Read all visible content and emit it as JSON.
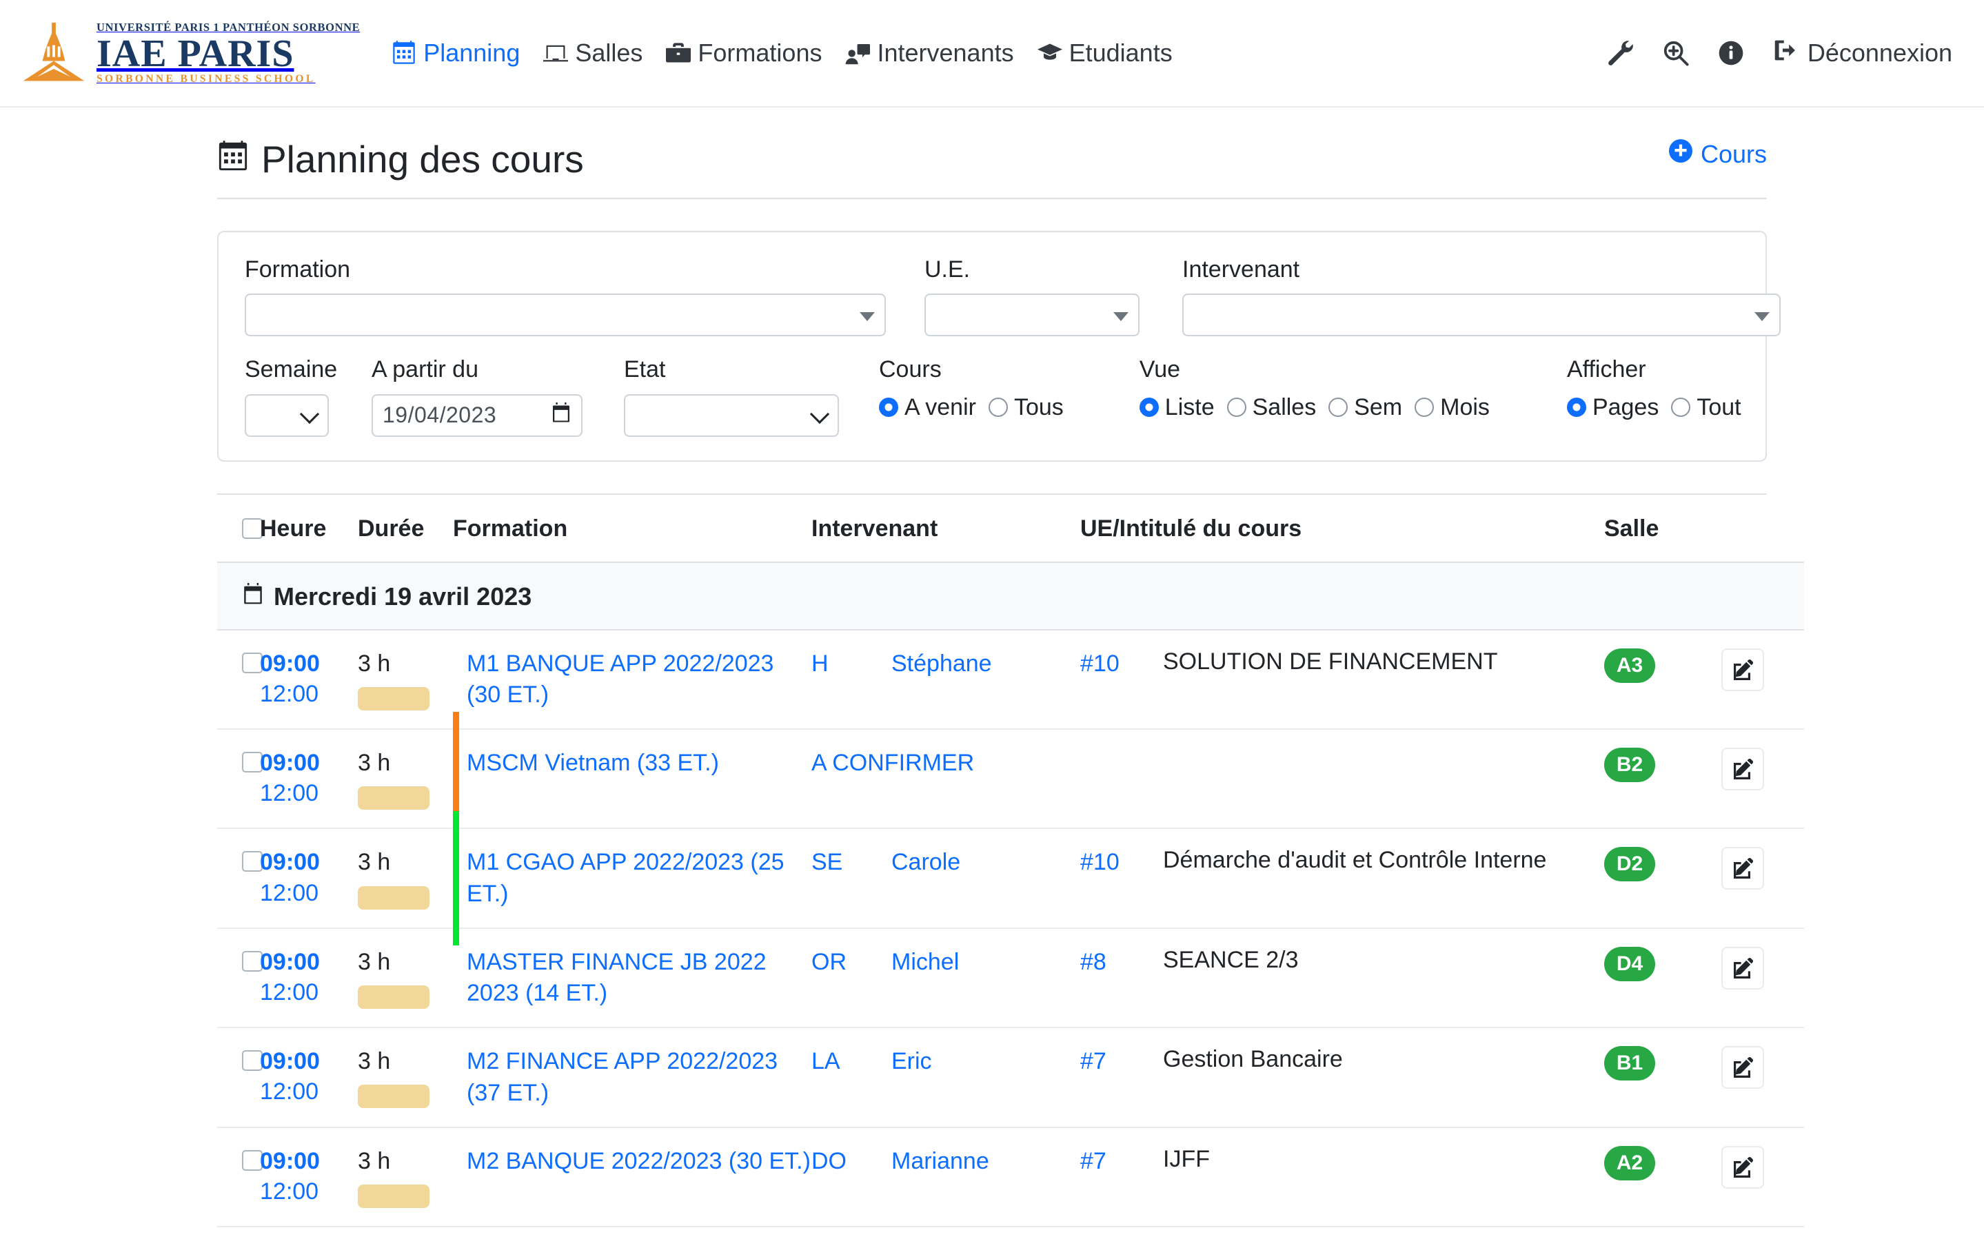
{
  "brand": {
    "line1": "UNIVERSITÉ PARIS 1 PANTHÉON SORBONNE",
    "line2": "IAE PARIS",
    "line3": "SORBONNE BUSINESS SCHOOL"
  },
  "nav": {
    "items": [
      {
        "label": "Planning",
        "icon": "calendar-icon",
        "active": true
      },
      {
        "label": "Salles",
        "icon": "laptop-icon",
        "active": false
      },
      {
        "label": "Formations",
        "icon": "briefcase-icon",
        "active": false
      },
      {
        "label": "Intervenants",
        "icon": "user-card-icon",
        "active": false
      },
      {
        "label": "Etudiants",
        "icon": "graduation-cap-icon",
        "active": false
      }
    ],
    "right_icons": [
      "wrench-icon",
      "search-plus-icon",
      "info-circle-icon"
    ],
    "logout_label": "Déconnexion"
  },
  "page": {
    "title": "Planning des cours",
    "add_button": "Cours"
  },
  "filters": {
    "formation": {
      "label": "Formation",
      "value": ""
    },
    "ue": {
      "label": "U.E.",
      "value": ""
    },
    "intervenant": {
      "label": "Intervenant",
      "value": ""
    },
    "semaine": {
      "label": "Semaine",
      "value": ""
    },
    "apartirdu": {
      "label": "A partir du",
      "value": "19/04/2023"
    },
    "etat": {
      "label": "Etat",
      "value": ""
    },
    "cours": {
      "label": "Cours",
      "options": [
        {
          "label": "A venir",
          "selected": true
        },
        {
          "label": "Tous",
          "selected": false
        }
      ]
    },
    "vue": {
      "label": "Vue",
      "options": [
        {
          "label": "Liste",
          "selected": true
        },
        {
          "label": "Salles",
          "selected": false
        },
        {
          "label": "Sem",
          "selected": false
        },
        {
          "label": "Mois",
          "selected": false
        }
      ]
    },
    "afficher": {
      "label": "Afficher",
      "options": [
        {
          "label": "Pages",
          "selected": true
        },
        {
          "label": "Tout",
          "selected": false
        }
      ]
    }
  },
  "table": {
    "columns": {
      "heure": "Heure",
      "duree": "Durée",
      "formation": "Formation",
      "intervenant": "Intervenant",
      "ue": "UE/Intitulé du cours",
      "salle": "Salle"
    },
    "day_group": {
      "label": "Mercredi 19 avril 2023",
      "icon": "calendar-icon"
    },
    "rows": [
      {
        "start": "09:00",
        "end": "12:00",
        "duration": "3 h",
        "accent": "",
        "formation": "M1 BANQUE APP 2022/2023 (30 ET.)",
        "intervenant_abbr": "H",
        "intervenant_first": "Stéphane",
        "ue_num": "#10",
        "ue_title": "SOLUTION DE FINANCEMENT",
        "salle": "A3"
      },
      {
        "start": "09:00",
        "end": "12:00",
        "duration": "3 h",
        "accent": "#fd7e14",
        "formation": "MSCM Vietnam (33 ET.)",
        "intervenant_abbr": "",
        "intervenant_first": "A CONFIRMER",
        "ue_num": "",
        "ue_title": "",
        "salle": "B2"
      },
      {
        "start": "09:00",
        "end": "12:00",
        "duration": "3 h",
        "accent": "#00e633",
        "formation": "M1 CGAO APP 2022/2023 (25 ET.)",
        "intervenant_abbr": "SE",
        "intervenant_first": "Carole",
        "ue_num": "#10",
        "ue_title": "Démarche d'audit et Contrôle Interne",
        "salle": "D2"
      },
      {
        "start": "09:00",
        "end": "12:00",
        "duration": "3 h",
        "accent": "",
        "formation": "MASTER FINANCE JB 2022 2023 (14 ET.)",
        "intervenant_abbr": "OR",
        "intervenant_first": "Michel",
        "ue_num": "#8",
        "ue_title": "SEANCE 2/3",
        "salle": "D4"
      },
      {
        "start": "09:00",
        "end": "12:00",
        "duration": "3 h",
        "accent": "",
        "formation": "M2 FINANCE APP 2022/2023 (37 ET.)",
        "intervenant_abbr": "LA",
        "intervenant_first": "Eric",
        "ue_num": "#7",
        "ue_title": "Gestion Bancaire",
        "salle": "B1"
      },
      {
        "start": "09:00",
        "end": "12:00",
        "duration": "3 h",
        "accent": "",
        "formation": "M2 BANQUE 2022/2023 (30 ET.)",
        "intervenant_abbr": "DO",
        "intervenant_first": "Marianne",
        "ue_num": "#7",
        "ue_title": "IJFF",
        "salle": "A2"
      }
    ]
  },
  "colors": {
    "accent_blue": "#0d6efd",
    "salle_green": "#28a745",
    "duration_bar": "#f2d79b",
    "brand_navy": "#1b3a63",
    "brand_orange": "#e8912d"
  }
}
